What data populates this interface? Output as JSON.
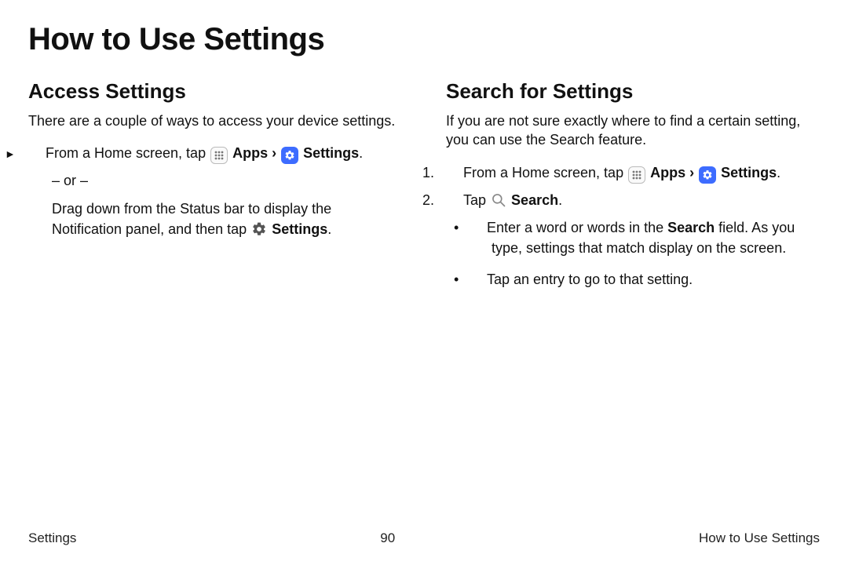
{
  "title": "How to Use Settings",
  "left": {
    "heading": "Access Settings",
    "intro": "There are a couple of ways to access your device settings.",
    "marker": "►",
    "step1_before": "From a Home screen, tap ",
    "apps_label": "Apps",
    "sep": " › ",
    "settings_label": "Settings",
    "period": ".",
    "or": "– or –",
    "alt_before": "Drag down from the Status bar to display the Notification panel, and then tap ",
    "alt_settings": "Settings",
    "alt_period": "."
  },
  "right": {
    "heading": "Search for Settings",
    "intro": "If you are not sure exactly where to find a certain setting, you can use the Search feature.",
    "num1": "1.",
    "step1_before": "From a Home screen, tap ",
    "apps_label": "Apps",
    "sep": " › ",
    "settings_label": "Settings",
    "period": ".",
    "num2": "2.",
    "step2_before": "Tap ",
    "search_label": "Search",
    "step2_after": ".",
    "bullet": "•",
    "b1_before": "Enter a word or words in the ",
    "b1_bold": "Search",
    "b1_after": " field. As you type, settings that match display on the screen.",
    "b2": "Tap an entry to go to that setting."
  },
  "footer": {
    "left": "Settings",
    "center": "90",
    "right": "How to Use Settings"
  }
}
